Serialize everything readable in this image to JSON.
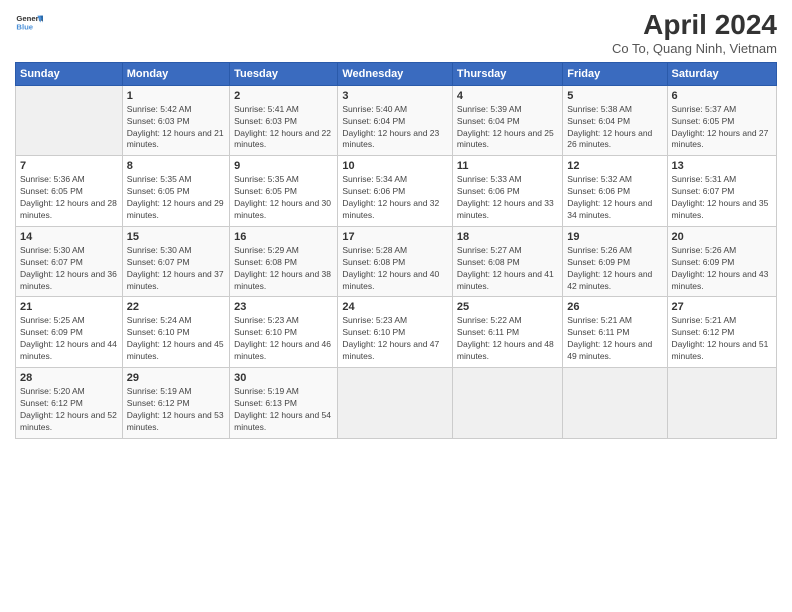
{
  "header": {
    "logo_line1": "General",
    "logo_line2": "Blue",
    "title": "April 2024",
    "subtitle": "Co To, Quang Ninh, Vietnam"
  },
  "weekdays": [
    "Sunday",
    "Monday",
    "Tuesday",
    "Wednesday",
    "Thursday",
    "Friday",
    "Saturday"
  ],
  "weeks": [
    [
      {
        "day": "",
        "sunrise": "",
        "sunset": "",
        "daylight": ""
      },
      {
        "day": "1",
        "sunrise": "Sunrise: 5:42 AM",
        "sunset": "Sunset: 6:03 PM",
        "daylight": "Daylight: 12 hours and 21 minutes."
      },
      {
        "day": "2",
        "sunrise": "Sunrise: 5:41 AM",
        "sunset": "Sunset: 6:03 PM",
        "daylight": "Daylight: 12 hours and 22 minutes."
      },
      {
        "day": "3",
        "sunrise": "Sunrise: 5:40 AM",
        "sunset": "Sunset: 6:04 PM",
        "daylight": "Daylight: 12 hours and 23 minutes."
      },
      {
        "day": "4",
        "sunrise": "Sunrise: 5:39 AM",
        "sunset": "Sunset: 6:04 PM",
        "daylight": "Daylight: 12 hours and 25 minutes."
      },
      {
        "day": "5",
        "sunrise": "Sunrise: 5:38 AM",
        "sunset": "Sunset: 6:04 PM",
        "daylight": "Daylight: 12 hours and 26 minutes."
      },
      {
        "day": "6",
        "sunrise": "Sunrise: 5:37 AM",
        "sunset": "Sunset: 6:05 PM",
        "daylight": "Daylight: 12 hours and 27 minutes."
      }
    ],
    [
      {
        "day": "7",
        "sunrise": "Sunrise: 5:36 AM",
        "sunset": "Sunset: 6:05 PM",
        "daylight": "Daylight: 12 hours and 28 minutes."
      },
      {
        "day": "8",
        "sunrise": "Sunrise: 5:35 AM",
        "sunset": "Sunset: 6:05 PM",
        "daylight": "Daylight: 12 hours and 29 minutes."
      },
      {
        "day": "9",
        "sunrise": "Sunrise: 5:35 AM",
        "sunset": "Sunset: 6:05 PM",
        "daylight": "Daylight: 12 hours and 30 minutes."
      },
      {
        "day": "10",
        "sunrise": "Sunrise: 5:34 AM",
        "sunset": "Sunset: 6:06 PM",
        "daylight": "Daylight: 12 hours and 32 minutes."
      },
      {
        "day": "11",
        "sunrise": "Sunrise: 5:33 AM",
        "sunset": "Sunset: 6:06 PM",
        "daylight": "Daylight: 12 hours and 33 minutes."
      },
      {
        "day": "12",
        "sunrise": "Sunrise: 5:32 AM",
        "sunset": "Sunset: 6:06 PM",
        "daylight": "Daylight: 12 hours and 34 minutes."
      },
      {
        "day": "13",
        "sunrise": "Sunrise: 5:31 AM",
        "sunset": "Sunset: 6:07 PM",
        "daylight": "Daylight: 12 hours and 35 minutes."
      }
    ],
    [
      {
        "day": "14",
        "sunrise": "Sunrise: 5:30 AM",
        "sunset": "Sunset: 6:07 PM",
        "daylight": "Daylight: 12 hours and 36 minutes."
      },
      {
        "day": "15",
        "sunrise": "Sunrise: 5:30 AM",
        "sunset": "Sunset: 6:07 PM",
        "daylight": "Daylight: 12 hours and 37 minutes."
      },
      {
        "day": "16",
        "sunrise": "Sunrise: 5:29 AM",
        "sunset": "Sunset: 6:08 PM",
        "daylight": "Daylight: 12 hours and 38 minutes."
      },
      {
        "day": "17",
        "sunrise": "Sunrise: 5:28 AM",
        "sunset": "Sunset: 6:08 PM",
        "daylight": "Daylight: 12 hours and 40 minutes."
      },
      {
        "day": "18",
        "sunrise": "Sunrise: 5:27 AM",
        "sunset": "Sunset: 6:08 PM",
        "daylight": "Daylight: 12 hours and 41 minutes."
      },
      {
        "day": "19",
        "sunrise": "Sunrise: 5:26 AM",
        "sunset": "Sunset: 6:09 PM",
        "daylight": "Daylight: 12 hours and 42 minutes."
      },
      {
        "day": "20",
        "sunrise": "Sunrise: 5:26 AM",
        "sunset": "Sunset: 6:09 PM",
        "daylight": "Daylight: 12 hours and 43 minutes."
      }
    ],
    [
      {
        "day": "21",
        "sunrise": "Sunrise: 5:25 AM",
        "sunset": "Sunset: 6:09 PM",
        "daylight": "Daylight: 12 hours and 44 minutes."
      },
      {
        "day": "22",
        "sunrise": "Sunrise: 5:24 AM",
        "sunset": "Sunset: 6:10 PM",
        "daylight": "Daylight: 12 hours and 45 minutes."
      },
      {
        "day": "23",
        "sunrise": "Sunrise: 5:23 AM",
        "sunset": "Sunset: 6:10 PM",
        "daylight": "Daylight: 12 hours and 46 minutes."
      },
      {
        "day": "24",
        "sunrise": "Sunrise: 5:23 AM",
        "sunset": "Sunset: 6:10 PM",
        "daylight": "Daylight: 12 hours and 47 minutes."
      },
      {
        "day": "25",
        "sunrise": "Sunrise: 5:22 AM",
        "sunset": "Sunset: 6:11 PM",
        "daylight": "Daylight: 12 hours and 48 minutes."
      },
      {
        "day": "26",
        "sunrise": "Sunrise: 5:21 AM",
        "sunset": "Sunset: 6:11 PM",
        "daylight": "Daylight: 12 hours and 49 minutes."
      },
      {
        "day": "27",
        "sunrise": "Sunrise: 5:21 AM",
        "sunset": "Sunset: 6:12 PM",
        "daylight": "Daylight: 12 hours and 51 minutes."
      }
    ],
    [
      {
        "day": "28",
        "sunrise": "Sunrise: 5:20 AM",
        "sunset": "Sunset: 6:12 PM",
        "daylight": "Daylight: 12 hours and 52 minutes."
      },
      {
        "day": "29",
        "sunrise": "Sunrise: 5:19 AM",
        "sunset": "Sunset: 6:12 PM",
        "daylight": "Daylight: 12 hours and 53 minutes."
      },
      {
        "day": "30",
        "sunrise": "Sunrise: 5:19 AM",
        "sunset": "Sunset: 6:13 PM",
        "daylight": "Daylight: 12 hours and 54 minutes."
      },
      {
        "day": "",
        "sunrise": "",
        "sunset": "",
        "daylight": ""
      },
      {
        "day": "",
        "sunrise": "",
        "sunset": "",
        "daylight": ""
      },
      {
        "day": "",
        "sunrise": "",
        "sunset": "",
        "daylight": ""
      },
      {
        "day": "",
        "sunrise": "",
        "sunset": "",
        "daylight": ""
      }
    ]
  ]
}
